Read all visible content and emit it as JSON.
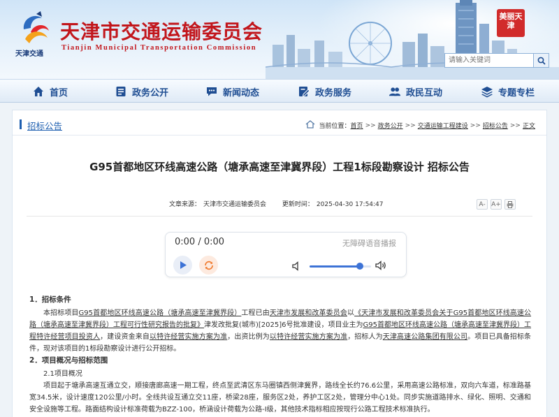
{
  "header": {
    "logo_caption": "天津交通",
    "title": "天津市交通运输委员会",
    "subtitle": "Tianjin Municipal Transportation Commission",
    "seal_text": "美丽天津",
    "search_placeholder": "请输入关键词"
  },
  "nav": [
    {
      "label": "首页",
      "icon": "home-icon"
    },
    {
      "label": "政务公开",
      "icon": "book-icon"
    },
    {
      "label": "新闻动态",
      "icon": "chat-icon"
    },
    {
      "label": "政务服务",
      "icon": "edit-icon"
    },
    {
      "label": "政民互动",
      "icon": "people-icon"
    },
    {
      "label": "专题专栏",
      "icon": "layers-icon"
    }
  ],
  "breadcrumb": {
    "section": "招标公告",
    "prefix": "当前位置：",
    "items": [
      "首页",
      "政务公开",
      "交通运输工程建设",
      "招标公告",
      "正文"
    ],
    "sep": ">>"
  },
  "article": {
    "title": "G95首都地区环线高速公路（塘承高速至津冀界段）工程1标段勘察设计 招标公告",
    "source_label": "文章来源：",
    "source": "天津市交通运输委员会",
    "updated_label": "更新时间：",
    "updated": "2025-04-30 17:54:47",
    "font_tools": [
      "A-",
      "A+",
      "print"
    ]
  },
  "player": {
    "time": "0:00 / 0:00",
    "label": "无障碍语音播报",
    "volume": 0.82
  },
  "body": {
    "h1": "1．招标条件",
    "p1_a": "本招标项目",
    "p1_b": "G95首都地区环线高速公路（塘承高速至津冀界段）",
    "p1_c": "工程已由",
    "p1_d": "天津市发展和改革委员会",
    "p1_e": "以",
    "p1_f": "《天津市发展和改革委员会关于G95首都地区环线高速公路（塘承高速至津冀界段）工程可行性研究报告的批复》",
    "p1_g": "津发改批复(城市)[2025]6号批准建设，项目业主为",
    "p1_h": "G95首都地区环线高速公路（塘承高速至津冀界段）工程特许经营项目投资人",
    "p1_i": "，建设资金来自",
    "p1_j": "以特许经营实施方案为准",
    "p1_k": "，出资比例为",
    "p1_l": "以特许经营实施方案为准",
    "p1_m": "，招标人为",
    "p1_n": "天津高速公路集团有限公司",
    "p1_o": "。项目已具备招标条件，现对该项目的1标段勘察设计进行公开招标。",
    "h2": "2．项目概况与招标范围",
    "s21": "2.1项目概况",
    "p2": "项目起于塘承高速互通立交，顺接唐廊高速一期工程，终点至武清区东马圈镇西侧津冀界，路线全长约76.6公里，采用高速公路标准，双向六车道，标准路基宽34.5米，设计速度120公里/小时。全线共设互通立交11座，桥梁28座，服务区2处，养护工区2处，管理分中心1处。同步实施道路排水、绿化、照明、交通和安全设施等工程。路面结构设计标准荷载为BZZ-100，桥涵设计荷载为公路-I级，其他技术指标相应按现行公路工程技术标准执行。"
  },
  "colors": {
    "title_red": "#c2161c",
    "nav_blue": "#1f4e93",
    "link_blue": "#1e5fb0",
    "accent": "#3d73d6"
  }
}
